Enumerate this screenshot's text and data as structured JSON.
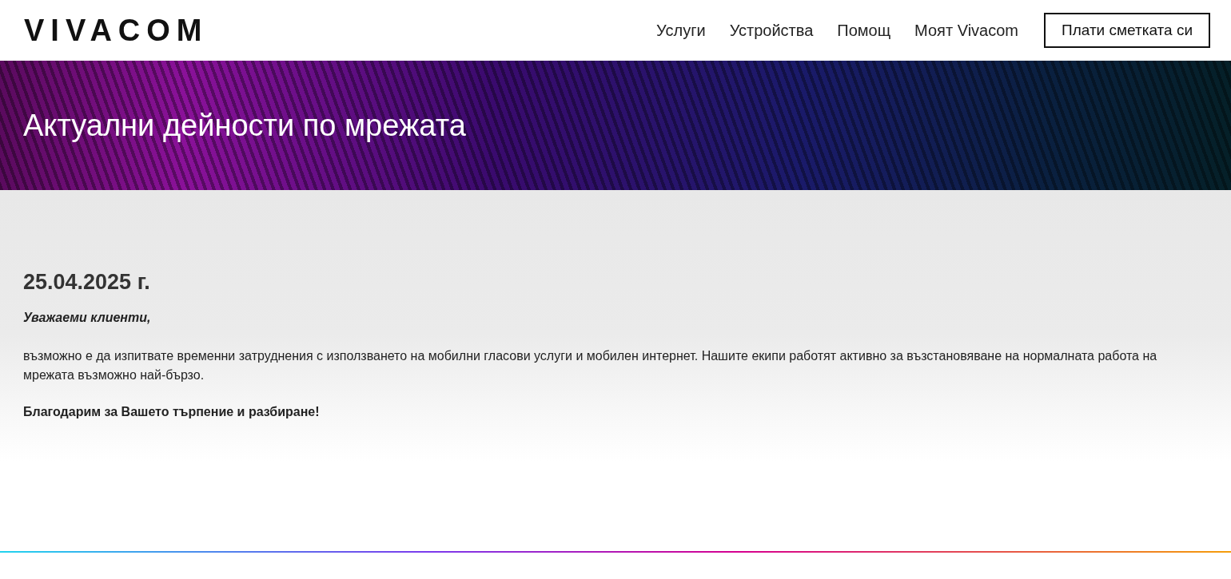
{
  "header": {
    "logo": "VIVACOM",
    "nav": [
      {
        "label": "Услуги"
      },
      {
        "label": "Устройства"
      },
      {
        "label": "Помощ"
      },
      {
        "label": "Моят Vivacom"
      }
    ],
    "cta": "Плати сметката си"
  },
  "hero": {
    "title": "Актуални дейности по мрежата"
  },
  "notice": {
    "date": "25.04.2025 г.",
    "greeting": "Уважаеми клиенти,",
    "body": "възможно е да изпитвате временни затруднения с използването на мобилни гласови услуги и мобилен интернет. Нашите екипи работят активно за възстановяване на нормалната работа на мрежата възможно най-бързо.",
    "closing": "Благодарим за Вашето търпение и разбиране!"
  }
}
